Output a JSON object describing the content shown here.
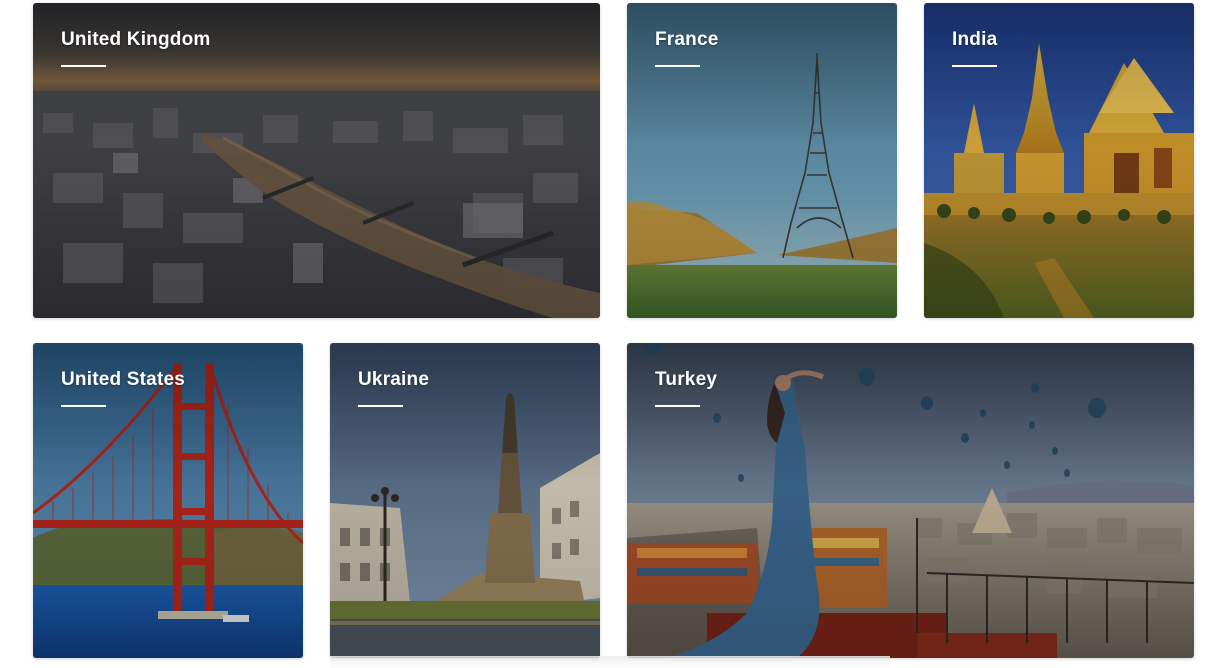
{
  "destinations": [
    {
      "name": "United Kingdom",
      "scene": "city-river-aerial-photo"
    },
    {
      "name": "France",
      "scene": "eiffel-tower-photo"
    },
    {
      "name": "India",
      "scene": "golden-temple-photo"
    },
    {
      "name": "United States",
      "scene": "golden-gate-bridge-photo"
    },
    {
      "name": "Ukraine",
      "scene": "monument-square-photo"
    },
    {
      "name": "Turkey",
      "scene": "hot-air-balloons-terrace-photo"
    }
  ]
}
